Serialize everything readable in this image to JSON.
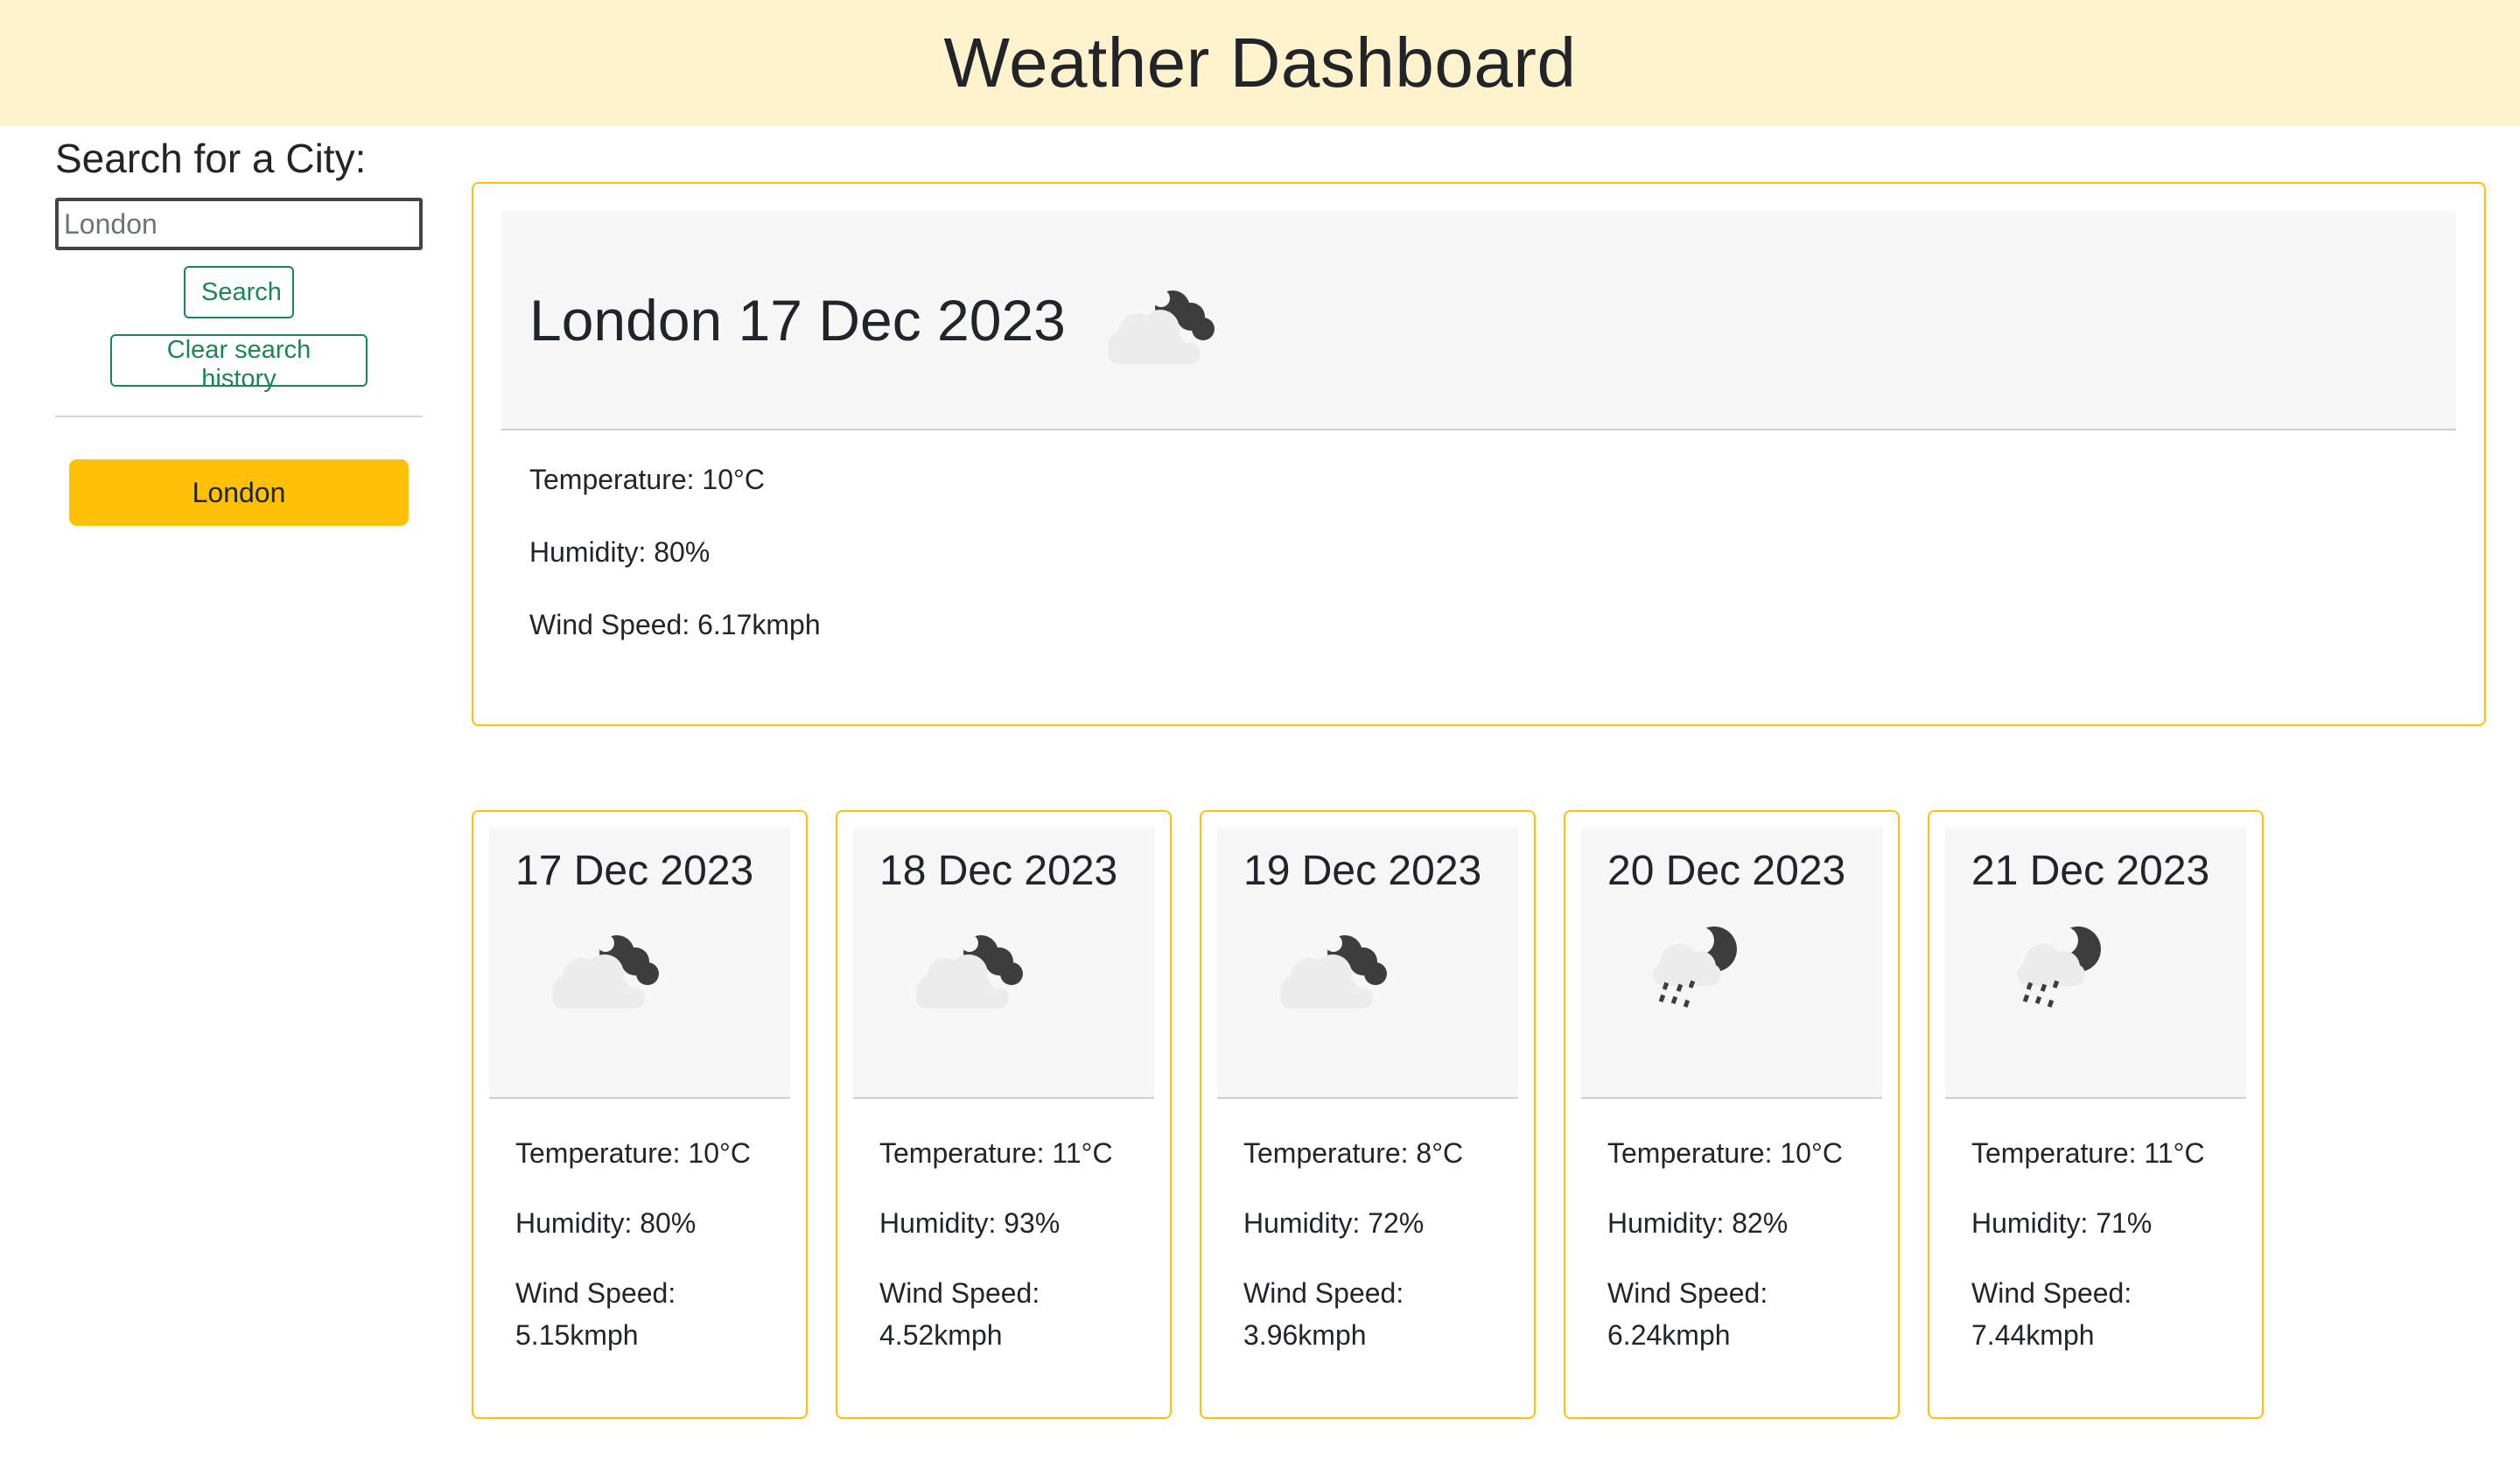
{
  "header": {
    "title": "Weather Dashboard"
  },
  "sidebar": {
    "heading": "Search for a City:",
    "search_placeholder": "London",
    "search_button": "Search",
    "clear_button": "Clear search history",
    "history": [
      "London"
    ]
  },
  "current": {
    "city": "London",
    "date": "17 Dec 2023",
    "icon": "cloudy-night-icon",
    "temperature": "Temperature: 10°C",
    "humidity": "Humidity: 80%",
    "wind": "Wind Speed: 6.17kmph"
  },
  "forecast": [
    {
      "date": "17 Dec 2023",
      "icon": "cloudy-night-icon",
      "temperature": "Temperature: 10°C",
      "humidity": "Humidity: 80%",
      "wind_label": "Wind Speed:",
      "wind_value": "5.15kmph"
    },
    {
      "date": "18 Dec 2023",
      "icon": "cloudy-night-icon",
      "temperature": "Temperature: 11°C",
      "humidity": "Humidity: 93%",
      "wind_label": "Wind Speed:",
      "wind_value": "4.52kmph"
    },
    {
      "date": "19 Dec 2023",
      "icon": "cloudy-night-icon",
      "temperature": "Temperature: 8°C",
      "humidity": "Humidity: 72%",
      "wind_label": "Wind Speed:",
      "wind_value": "3.96kmph"
    },
    {
      "date": "20 Dec 2023",
      "icon": "rain-night-icon",
      "temperature": "Temperature: 10°C",
      "humidity": "Humidity: 82%",
      "wind_label": "Wind Speed:",
      "wind_value": "6.24kmph"
    },
    {
      "date": "21 Dec 2023",
      "icon": "rain-night-icon",
      "temperature": "Temperature: 11°C",
      "humidity": "Humidity: 71%",
      "wind_label": "Wind Speed:",
      "wind_value": "7.44kmph"
    }
  ],
  "colors": {
    "accent": "#ffc107",
    "header_bg": "#fff3cd",
    "button_outline": "#198754"
  }
}
